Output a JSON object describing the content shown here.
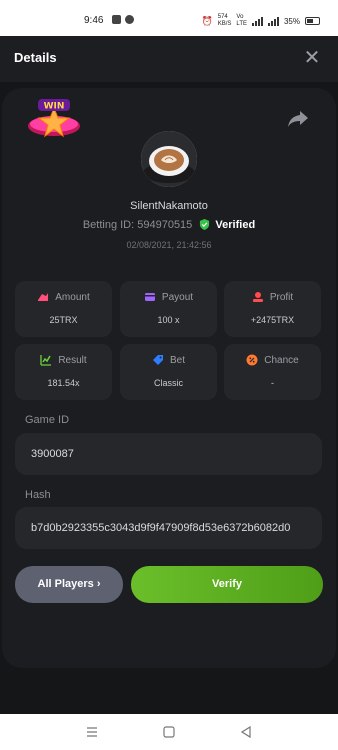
{
  "status_bar": {
    "time": "9:46",
    "network_speed": "574\nKB/S",
    "network_type": "Vo\nLTE",
    "battery": "35%"
  },
  "header": {
    "title": "Details",
    "close_icon": "close-icon"
  },
  "bet": {
    "badge_text": "WIN",
    "username": "SilentNakamoto",
    "betting_id_label": "Betting ID:",
    "betting_id": "594970515",
    "verified": "Verified",
    "datetime": "02/08/2021, 21:42:56"
  },
  "stats": {
    "amount": {
      "label": "Amount",
      "value": "25TRX",
      "color": "#ff4f7a"
    },
    "payout": {
      "label": "Payout",
      "value": "100 x",
      "color": "#a064ff"
    },
    "profit": {
      "label": "Profit",
      "value": "+2475TRX",
      "color": "#ff4d4d"
    },
    "result": {
      "label": "Result",
      "value": "181.54x",
      "color": "#6ad43a"
    },
    "bet": {
      "label": "Bet",
      "value": "Classic",
      "color": "#2f7dff"
    },
    "chance": {
      "label": "Chance",
      "value": "-",
      "color": "#ff7a2f"
    }
  },
  "game_id": {
    "label": "Game ID",
    "value": "3900087"
  },
  "hash": {
    "label": "Hash",
    "value": "b7d0b2923355c3043d9f9f47909f8d53e6372b6082d0"
  },
  "actions": {
    "all_players": "All Players ›",
    "verify": "Verify"
  },
  "colors": {
    "accent_green": "#5cae1f",
    "background": "#151618"
  }
}
